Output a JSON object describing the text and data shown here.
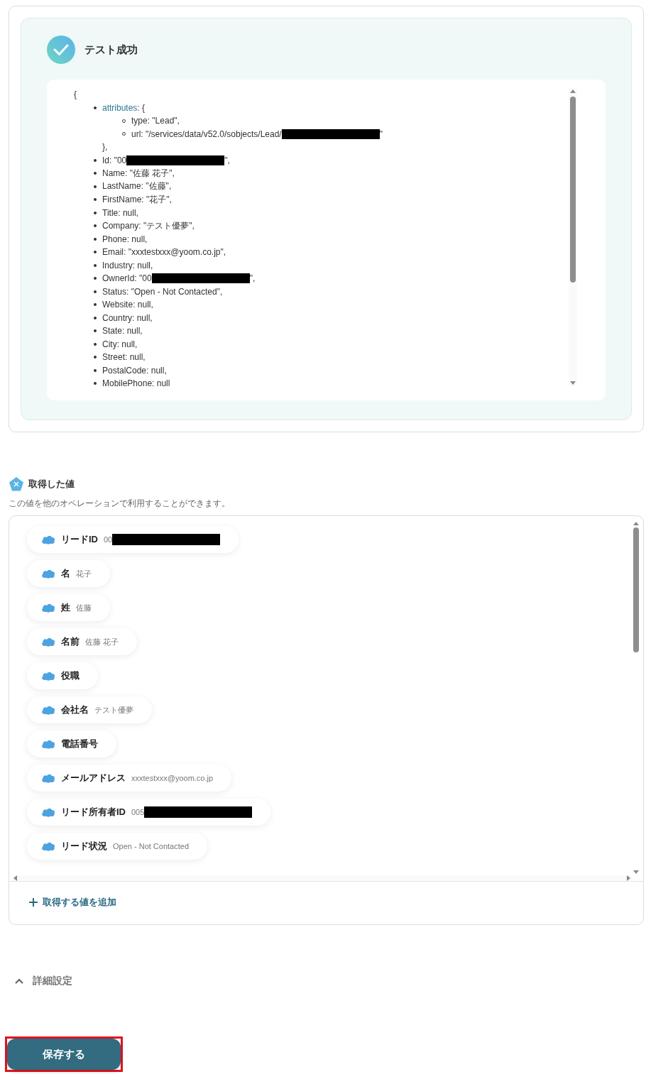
{
  "test_result": {
    "title": "テスト成功",
    "json_open": "{",
    "lines": [
      {
        "key": "attributes",
        "text": ": {",
        "children": [
          {
            "text": "type: \"Lead\","
          },
          {
            "text": "url: \"/services/data/v52.0/sobjects/Lead/",
            "redacted": true,
            "tail": "\""
          }
        ],
        "close": "},"
      },
      {
        "text": "Id: \"00",
        "redacted": true,
        "tail": "\","
      },
      {
        "text": "Name: \"佐藤 花子\","
      },
      {
        "text": "LastName: \"佐藤\","
      },
      {
        "text": "FirstName: \"花子\","
      },
      {
        "text": "Title: null,"
      },
      {
        "text": "Company: \"テスト優夢\","
      },
      {
        "text": "Phone: null,"
      },
      {
        "text": "Email: \"xxxtestxxx@yoom.co.jp\","
      },
      {
        "text": "Industry: null,"
      },
      {
        "text": "OwnerId: \"00",
        "redacted": true,
        "tail": "\","
      },
      {
        "text": "Status: \"Open - Not Contacted\","
      },
      {
        "text": "Website: null,"
      },
      {
        "text": "Country: null,"
      },
      {
        "text": "State: null,"
      },
      {
        "text": "City: null,"
      },
      {
        "text": "Street: null,"
      },
      {
        "text": "PostalCode: null,"
      },
      {
        "text": "MobilePhone: null"
      }
    ]
  },
  "acquired_values": {
    "title": "取得した値",
    "description": "この値を他のオペレーションで利用することができます。",
    "items": [
      {
        "label": "リードID",
        "value": "00",
        "redacted": true
      },
      {
        "label": "名",
        "value": "花子"
      },
      {
        "label": "姓",
        "value": "佐藤"
      },
      {
        "label": "名前",
        "value": "佐藤 花子"
      },
      {
        "label": "役職"
      },
      {
        "label": "会社名",
        "value": "テスト優夢"
      },
      {
        "label": "電話番号"
      },
      {
        "label": "メールアドレス",
        "value": "xxxtestxxx@yoom.co.jp"
      },
      {
        "label": "リード所有者ID",
        "value": "005",
        "redacted": true
      },
      {
        "label": "リード状況",
        "value": "Open - Not Contacted"
      }
    ],
    "add_button": "取得する値を追加"
  },
  "advanced_settings": {
    "label": "詳細設定",
    "expanded": true
  },
  "save_button": {
    "label": "保存する",
    "highlighted": true
  }
}
